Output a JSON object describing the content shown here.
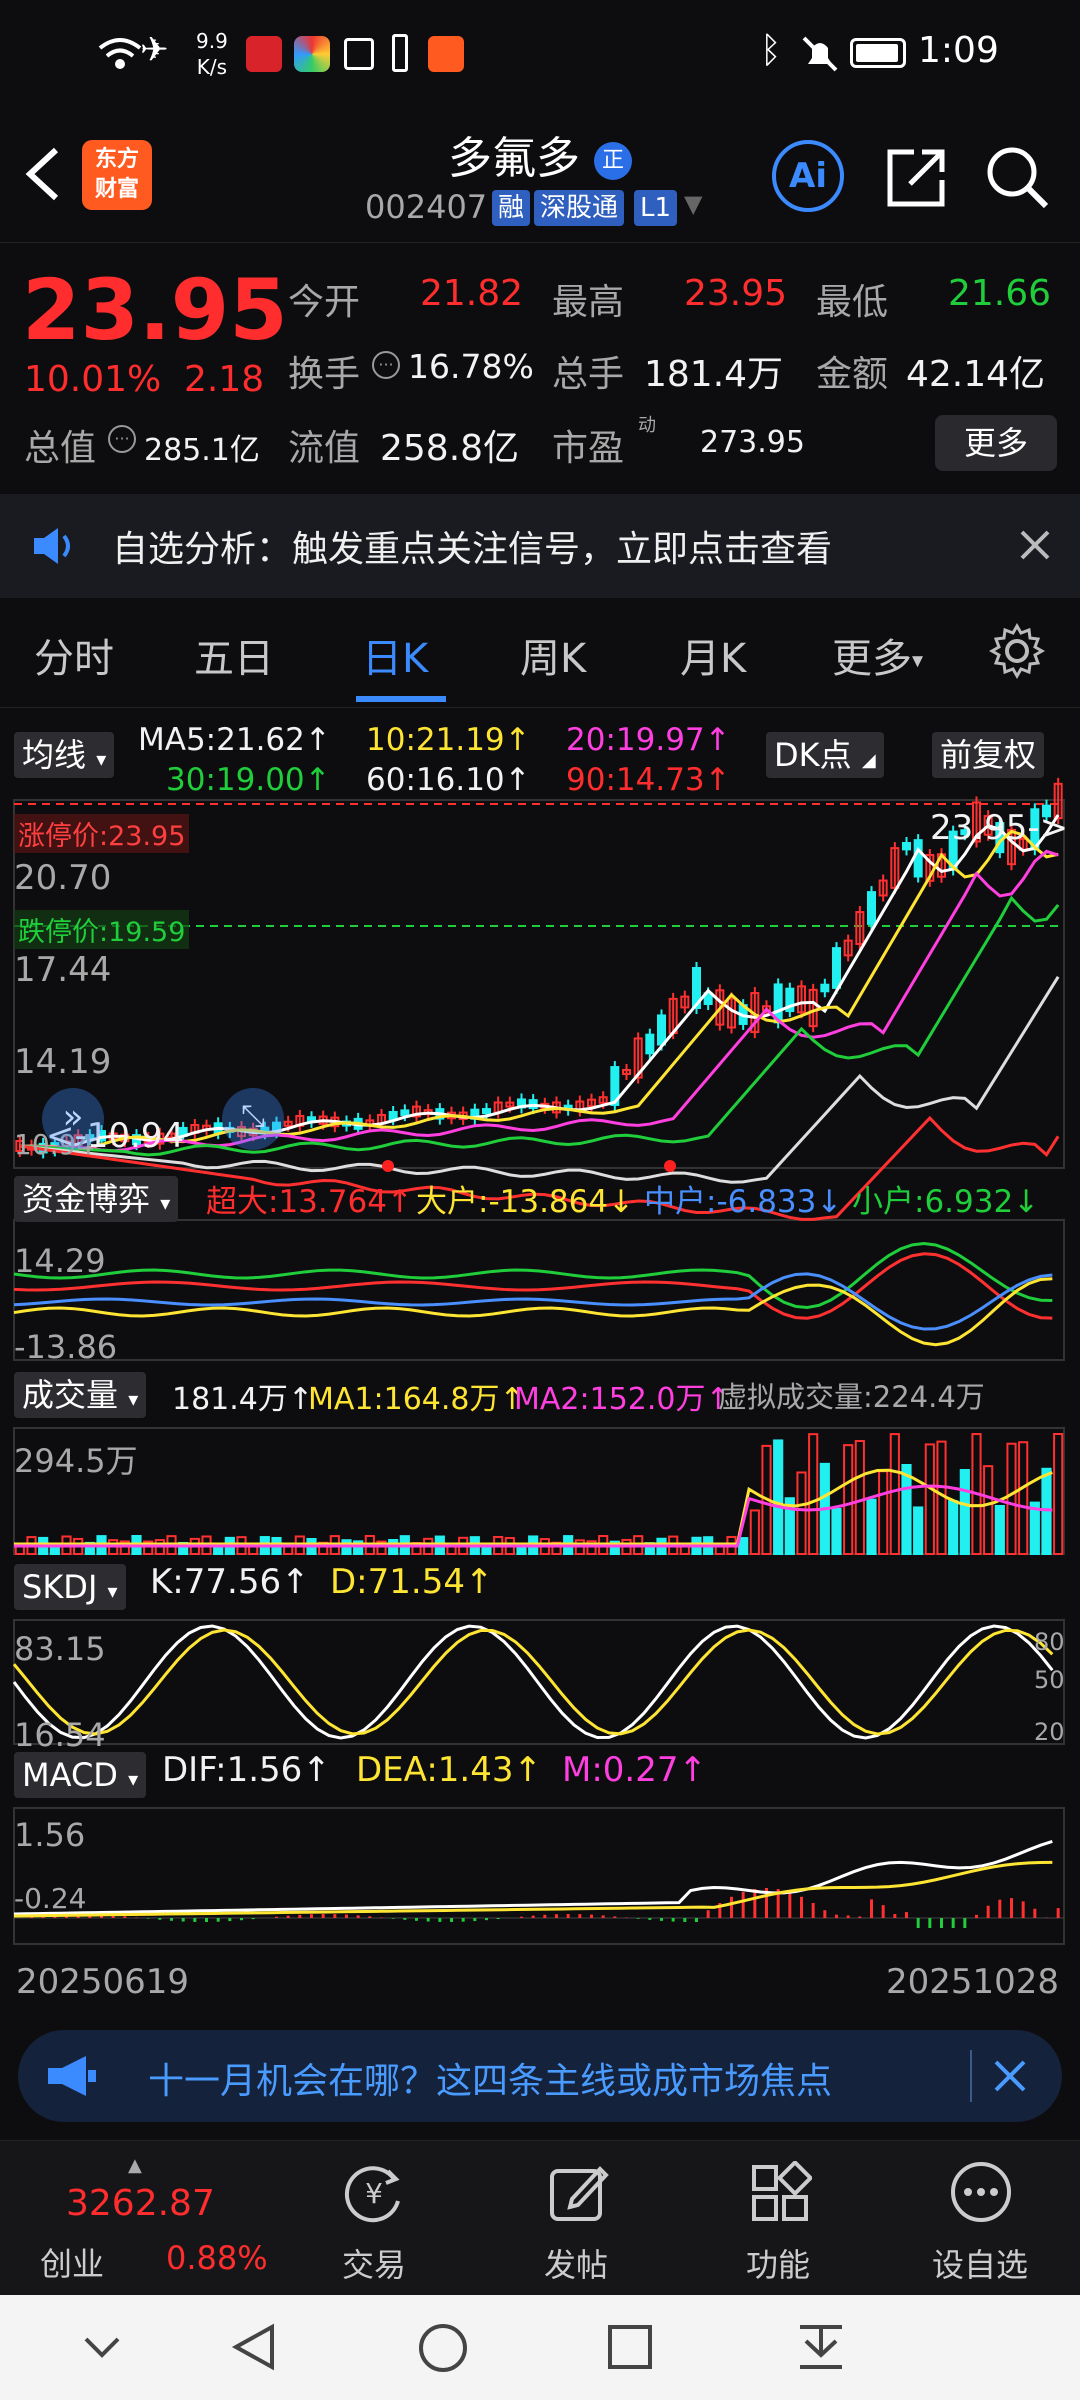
{
  "status_bar": {
    "speed_value": "9.9",
    "speed_unit": "K/s",
    "time": "1:09"
  },
  "header": {
    "logo_line1": "东方",
    "logo_line2": "财富",
    "stock_name": "多氟多",
    "zheng_badge": "正",
    "stock_code": "002407",
    "tag_rong": "融",
    "tag_sgt": "深股通",
    "tag_l1": "L1",
    "ai_label": "Ai"
  },
  "quote": {
    "price": "23.95",
    "change_pct": "10.01%",
    "change_amt": "2.18",
    "open_label": "今开",
    "open_value": "21.82",
    "high_label": "最高",
    "high_value": "23.95",
    "low_label": "最低",
    "low_value": "21.66",
    "turnover_label": "换手",
    "turnover_value": "16.78%",
    "volume_label": "总手",
    "volume_value": "181.4万",
    "amount_label": "金额",
    "amount_value": "42.14亿",
    "mktcap_label": "总值",
    "mktcap_value": "285.1亿",
    "float_label": "流值",
    "float_value": "258.8亿",
    "pe_label": "市盈",
    "pe_sup": "动",
    "pe_value": "273.95",
    "more_label": "更多"
  },
  "notice": {
    "text": "自选分析：触发重点关注信号，立即点击查看"
  },
  "tabs": [
    {
      "label": "分时"
    },
    {
      "label": "五日"
    },
    {
      "label": "日K"
    },
    {
      "label": "周K"
    },
    {
      "label": "月K"
    },
    {
      "label": "更多"
    }
  ],
  "active_tab": 2,
  "ma_panel": {
    "button": "均线",
    "ma5": "MA5:21.62↑",
    "ma10": "10:21.19↑",
    "ma20": "20:19.97↑",
    "ma30": "30:19.00↑",
    "ma60": "60:16.10↑",
    "ma90": "90:14.73↑",
    "dk_button": "DK点",
    "adjust_button": "前复权",
    "limit_up": "涨停价:23.95",
    "limit_down": "跌停价:19.59",
    "price_label": "23.95->",
    "low_marker": "<-10.94",
    "y_top": "23.95",
    "y_2": "20.70",
    "y_3": "17.44",
    "y_4": "14.19",
    "y_bottom": "10.94"
  },
  "fund_panel": {
    "button": "资金博弈",
    "super": "超大:13.764↑",
    "large": "大户:-13.864↓",
    "medium": "中户:-6.833↓",
    "small": "小户:6.932↓",
    "y_top": "14.29",
    "y_bottom": "-13.86"
  },
  "volume_panel": {
    "button": "成交量",
    "vol": "181.4万↑",
    "ma1": "MA1:164.8万↑",
    "ma2": "MA2:152.0万↑",
    "virtual": "虚拟成交量:224.4万",
    "y_top": "294.5万"
  },
  "skdj_panel": {
    "button": "SKDJ",
    "k": "K:77.56↑",
    "d": "D:71.54↑",
    "y_top": "83.15",
    "y_bottom": "16.54",
    "r80": "80",
    "r50": "50",
    "r20": "20"
  },
  "macd_panel": {
    "button": "MACD",
    "dif": "DIF:1.56↑",
    "dea": "DEA:1.43↑",
    "m": "M:0.27↑",
    "y_top": "1.56",
    "y_bottom": "-0.24"
  },
  "date_axis": {
    "start": "20250619",
    "end": "20251028"
  },
  "banner": {
    "text": "十一月机会在哪？这四条主线或成市场焦点"
  },
  "bottom_nav": {
    "index_value": "3262.87",
    "index_name": "创业",
    "index_change": "0.88%",
    "trade": "交易",
    "post": "发帖",
    "function": "功能",
    "add_watch": "设自选"
  },
  "colors": {
    "up_red": "#ff2d2d",
    "down_green": "#1fce3a",
    "accent_blue": "#3b8bff",
    "cyan_bar": "#22f0f0"
  }
}
